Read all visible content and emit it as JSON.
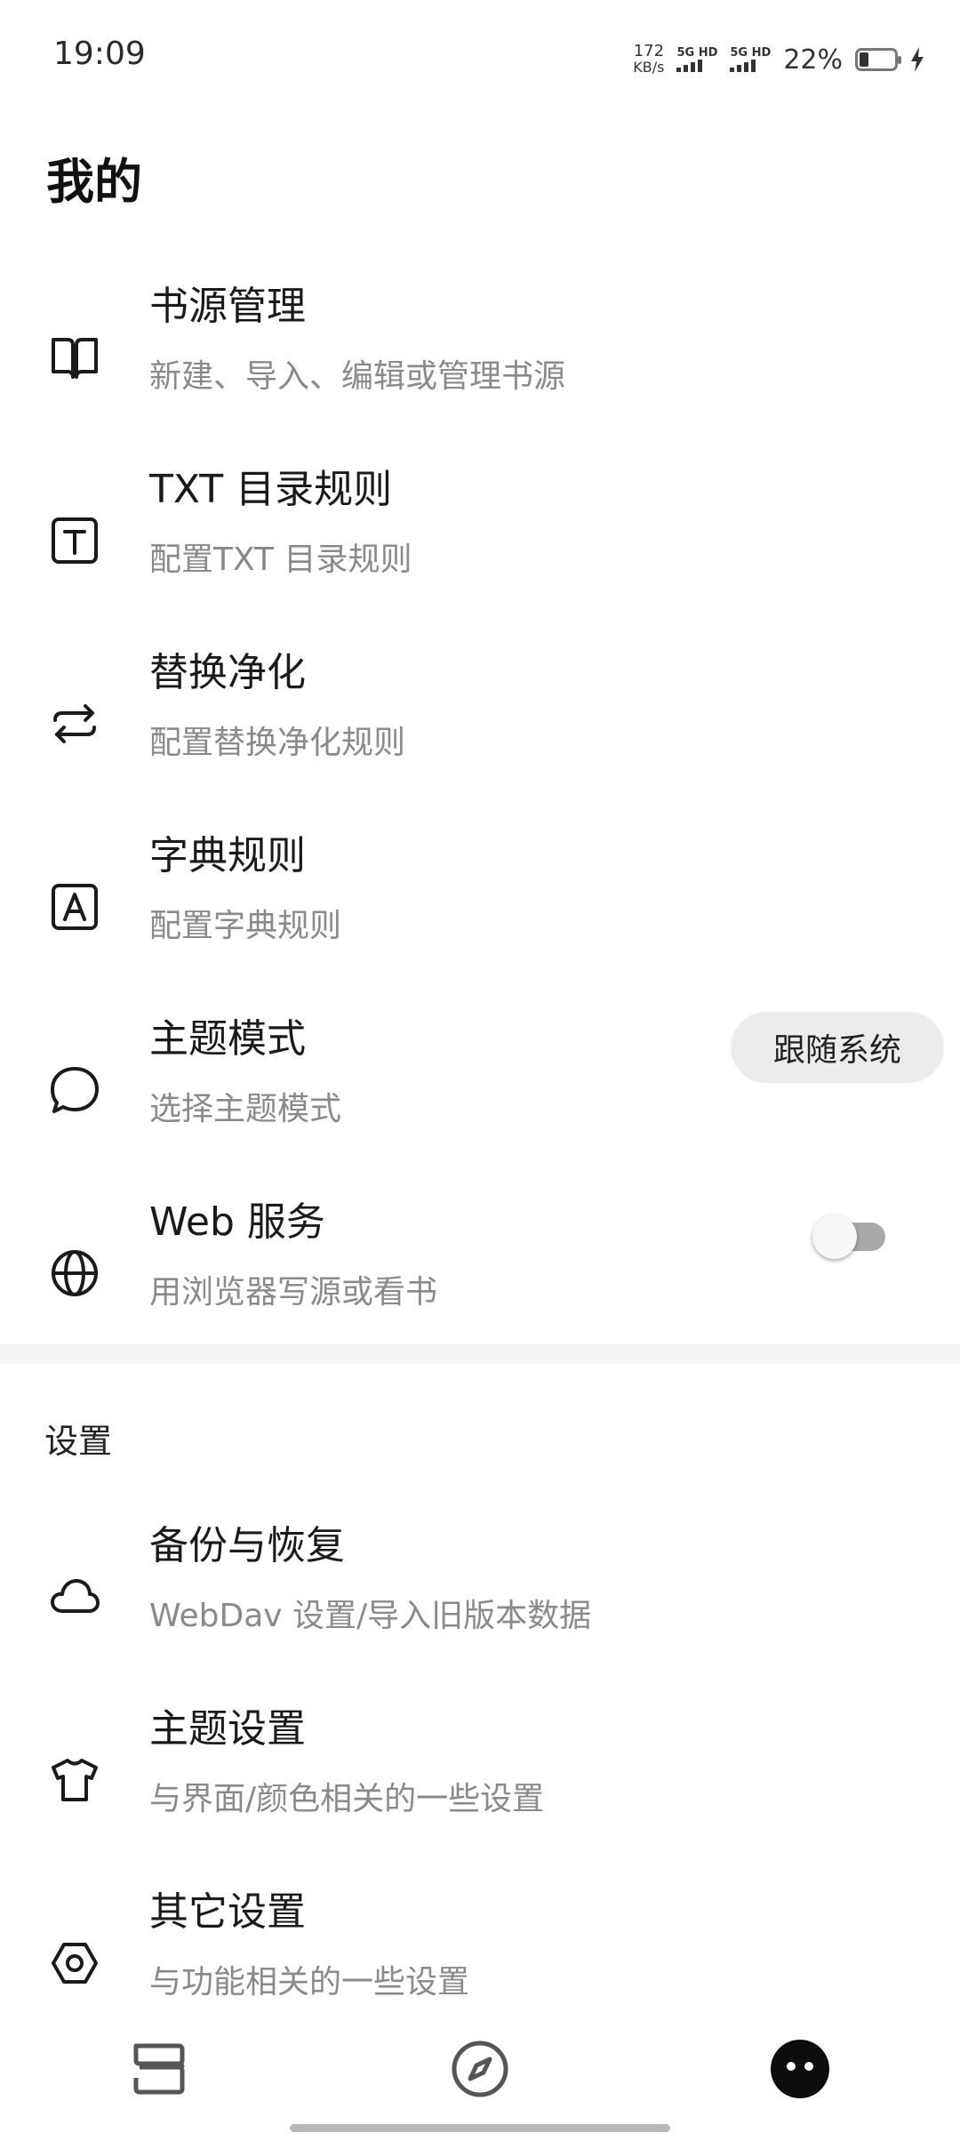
{
  "status_bar": {
    "time": "19:09",
    "speed_value": "172",
    "speed_unit": "KB/s",
    "sim1": "5G HD",
    "sim2": "5G HD",
    "battery_percent": "22%"
  },
  "page_title": "我的",
  "items": [
    {
      "title": "书源管理",
      "subtitle": "新建、导入、编辑或管理书源",
      "icon": "book-icon"
    },
    {
      "title": "TXT 目录规则",
      "subtitle": "配置TXT 目录规则",
      "icon": "text-t-icon"
    },
    {
      "title": "替换净化",
      "subtitle": "配置替换净化规则",
      "icon": "swap-icon"
    },
    {
      "title": "字典规则",
      "subtitle": "配置字典规则",
      "icon": "dictionary-a-icon"
    },
    {
      "title": "主题模式",
      "subtitle": "选择主题模式",
      "icon": "chat-bubble-icon",
      "value": "跟随系统"
    },
    {
      "title": "Web 服务",
      "subtitle": "用浏览器写源或看书",
      "icon": "globe-icon",
      "toggle_on": false
    }
  ],
  "settings_section": {
    "label": "设置",
    "items": [
      {
        "title": "备份与恢复",
        "subtitle": "WebDav 设置/导入旧版本数据",
        "icon": "cloud-icon"
      },
      {
        "title": "主题设置",
        "subtitle": "与界面/颜色相关的一些设置",
        "icon": "tshirt-icon"
      },
      {
        "title": "其它设置",
        "subtitle": "与功能相关的一些设置",
        "icon": "hexagon-settings-icon"
      }
    ]
  },
  "bottom_nav": [
    "bookshelf-icon",
    "compass-icon",
    "profile-icon"
  ]
}
